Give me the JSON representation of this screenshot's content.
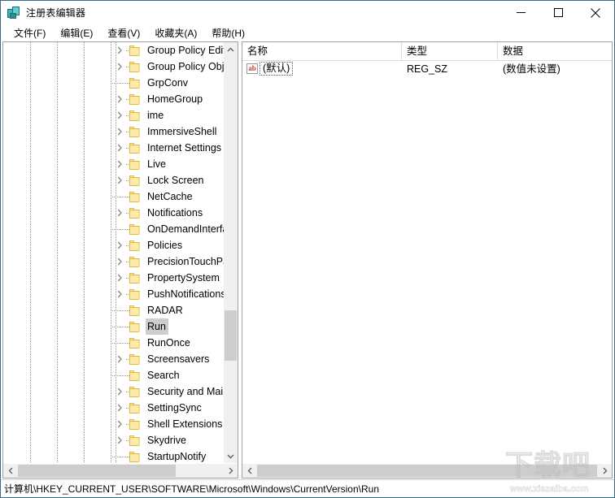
{
  "window": {
    "title": "注册表编辑器",
    "icon": "registry-editor-icon",
    "minimize_label": "—",
    "maximize_label": "□",
    "close_label": "✕"
  },
  "menubar": {
    "items": [
      {
        "label": "文件(F)"
      },
      {
        "label": "编辑(E)"
      },
      {
        "label": "查看(V)"
      },
      {
        "label": "收藏夹(A)"
      },
      {
        "label": "帮助(H)"
      }
    ]
  },
  "tree": {
    "items": [
      {
        "label": "Group Policy Editor",
        "expandable": true,
        "selected": false
      },
      {
        "label": "Group Policy Object",
        "expandable": true,
        "selected": false
      },
      {
        "label": "GrpConv",
        "expandable": false,
        "selected": false
      },
      {
        "label": "HomeGroup",
        "expandable": true,
        "selected": false
      },
      {
        "label": "ime",
        "expandable": true,
        "selected": false
      },
      {
        "label": "ImmersiveShell",
        "expandable": true,
        "selected": false
      },
      {
        "label": "Internet Settings",
        "expandable": true,
        "selected": false
      },
      {
        "label": "Live",
        "expandable": true,
        "selected": false
      },
      {
        "label": "Lock Screen",
        "expandable": true,
        "selected": false
      },
      {
        "label": "NetCache",
        "expandable": false,
        "selected": false
      },
      {
        "label": "Notifications",
        "expandable": true,
        "selected": false
      },
      {
        "label": "OnDemandInterface",
        "expandable": false,
        "selected": false
      },
      {
        "label": "Policies",
        "expandable": true,
        "selected": false
      },
      {
        "label": "PrecisionTouchPad",
        "expandable": true,
        "selected": false
      },
      {
        "label": "PropertySystem",
        "expandable": true,
        "selected": false
      },
      {
        "label": "PushNotifications",
        "expandable": true,
        "selected": false
      },
      {
        "label": "RADAR",
        "expandable": false,
        "selected": false
      },
      {
        "label": "Run",
        "expandable": false,
        "selected": true
      },
      {
        "label": "RunOnce",
        "expandable": false,
        "selected": false
      },
      {
        "label": "Screensavers",
        "expandable": true,
        "selected": false
      },
      {
        "label": "Search",
        "expandable": false,
        "selected": false
      },
      {
        "label": "Security and Mainte",
        "expandable": true,
        "selected": false
      },
      {
        "label": "SettingSync",
        "expandable": true,
        "selected": false
      },
      {
        "label": "Shell Extensions",
        "expandable": true,
        "selected": false
      },
      {
        "label": "Skydrive",
        "expandable": true,
        "selected": false
      },
      {
        "label": "StartupNotify",
        "expandable": false,
        "selected": false
      }
    ]
  },
  "list": {
    "columns": [
      {
        "label": "名称"
      },
      {
        "label": "类型"
      },
      {
        "label": "数据"
      }
    ],
    "rows": [
      {
        "icon": "string-value-icon",
        "icon_text": "ab",
        "name": "(默认)",
        "type": "REG_SZ",
        "data": "(数值未设置)",
        "focused": true
      }
    ]
  },
  "statusbar": {
    "path": "计算机\\HKEY_CURRENT_USER\\SOFTWARE\\Microsoft\\Windows\\CurrentVersion\\Run"
  },
  "watermark": {
    "brand": "下载吧",
    "url": "www.xiazaiba.com"
  },
  "colors": {
    "window_border": "#3d6d86",
    "folder_fill": "#fde9a9",
    "folder_stroke": "#e0b93c",
    "selection": "#cdcdcd",
    "scrollbar_thumb": "#cdcdcd",
    "scrollbar_track": "#f0f0f0",
    "icon_text": "#c0392b"
  }
}
